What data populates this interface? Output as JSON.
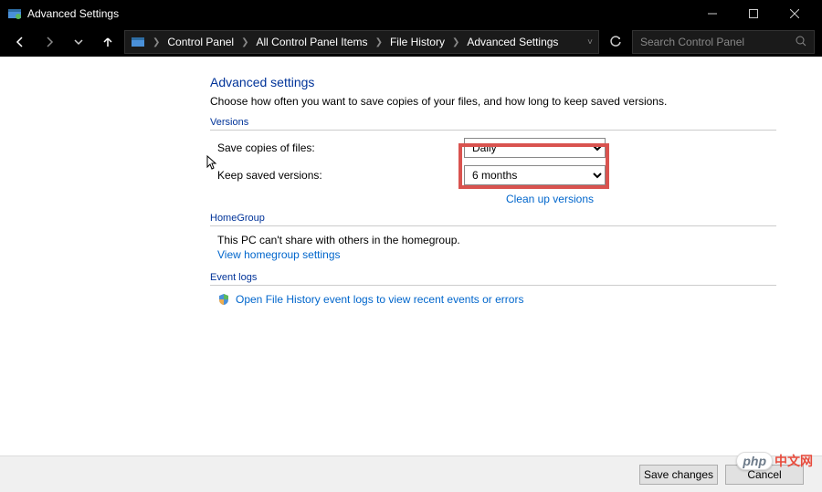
{
  "window": {
    "title": "Advanced Settings"
  },
  "breadcrumbs": {
    "items": [
      "Control Panel",
      "All Control Panel Items",
      "File History",
      "Advanced Settings"
    ]
  },
  "search": {
    "placeholder": "Search Control Panel"
  },
  "page": {
    "title": "Advanced settings",
    "description": "Choose how often you want to save copies of your files, and how long to keep saved versions."
  },
  "versions": {
    "header": "Versions",
    "save_copies_label": "Save copies of files:",
    "save_copies_value": "Daily",
    "keep_versions_label": "Keep saved versions:",
    "keep_versions_value": "6 months",
    "cleanup_link": "Clean up versions"
  },
  "homegroup": {
    "header": "HomeGroup",
    "body": "This PC can't share with others in the homegroup.",
    "link": "View homegroup settings"
  },
  "eventlogs": {
    "header": "Event logs",
    "link": "Open File History event logs to view recent events or errors"
  },
  "footer": {
    "save": "Save changes",
    "cancel": "Cancel"
  },
  "watermark": {
    "badge": "php",
    "text": "中文网"
  }
}
